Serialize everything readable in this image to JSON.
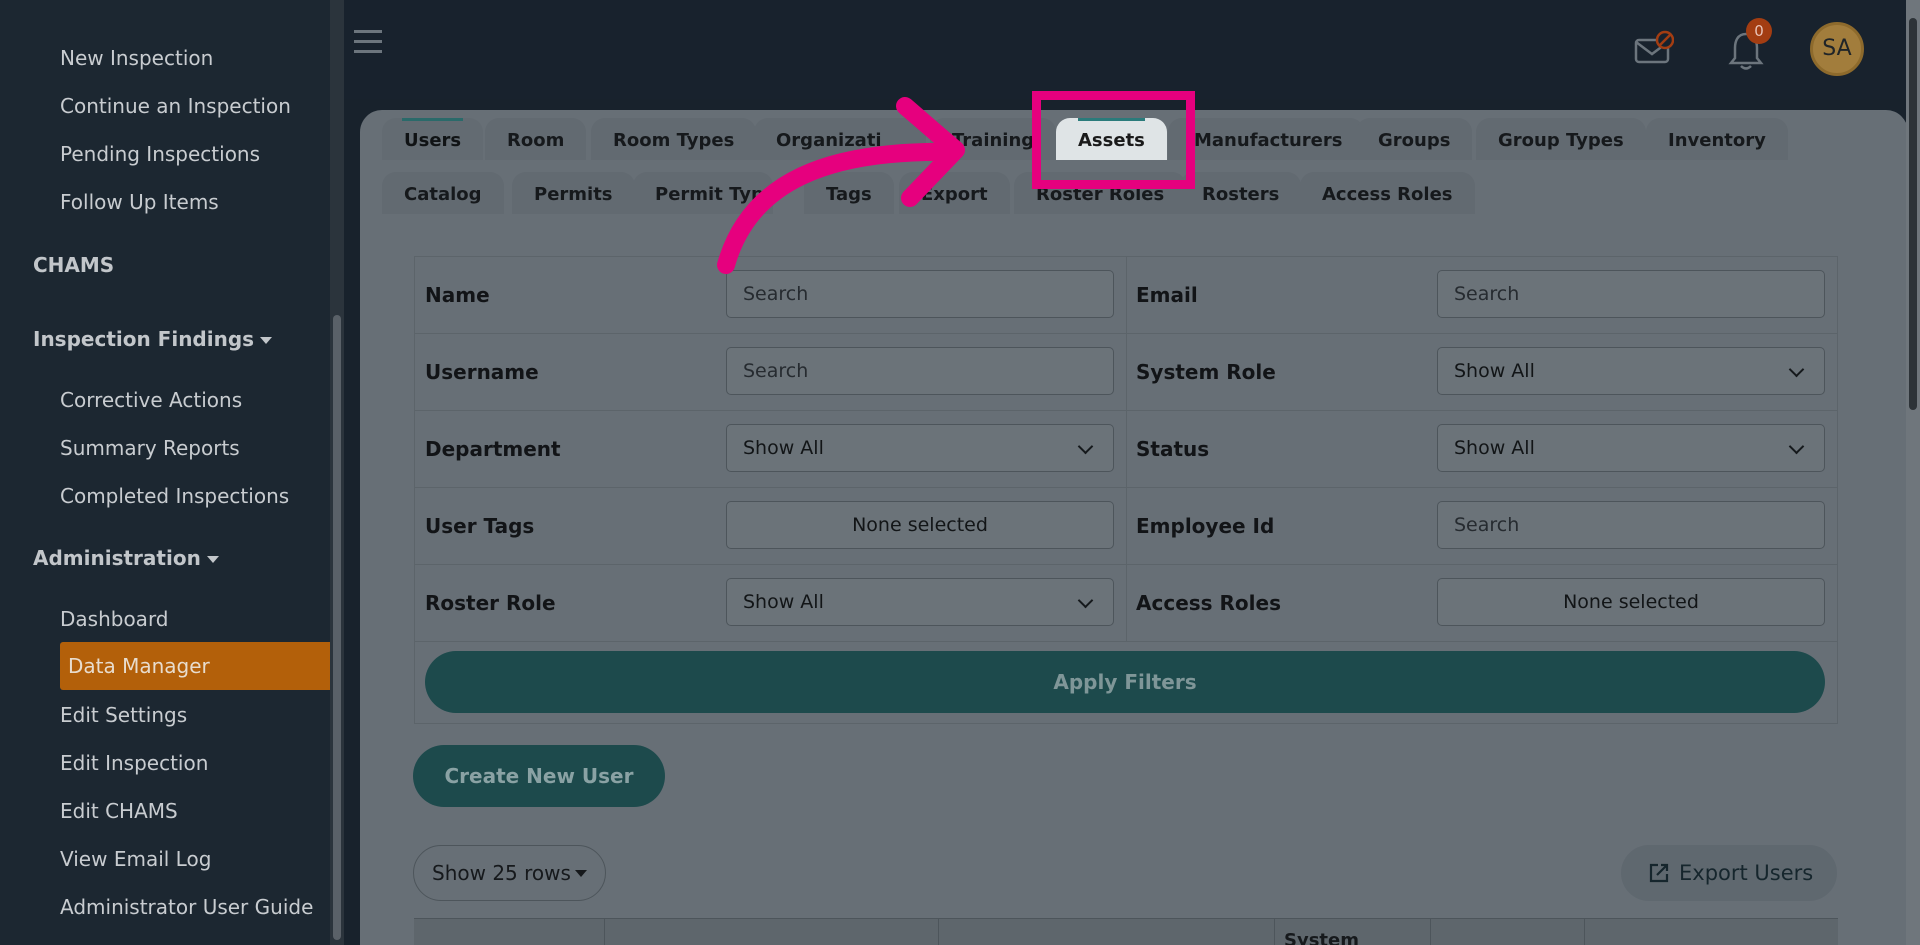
{
  "sidebar": {
    "inspection_items": [
      "New Inspection",
      "Continue an Inspection",
      "Pending Inspections",
      "Follow Up Items"
    ],
    "chams_label": "CHAMS",
    "findings_label": "Inspection Findings",
    "findings_items": [
      "Corrective Actions",
      "Summary Reports",
      "Completed Inspections"
    ],
    "admin_label": "Administration",
    "admin_items": [
      "Dashboard",
      "Data Manager",
      "Edit Settings",
      "Edit Inspection",
      "Edit CHAMS",
      "View Email Log",
      "Administrator User Guide"
    ],
    "active_item": "Data Manager"
  },
  "header": {
    "notification_count": "0",
    "avatar_initials": "SA",
    "icons": [
      "menu-icon",
      "mail-disabled-icon",
      "bell-icon"
    ]
  },
  "tabs": {
    "row1": [
      "Users",
      "Room",
      "Room Types",
      "Organizati",
      "Training",
      "Assets",
      "Manufacturers",
      "Groups",
      "Group Types",
      "Inventory"
    ],
    "row2": [
      "Catalog",
      "Permits",
      "Permit Typ",
      "Tags",
      "Export",
      "Roster Roles",
      "Rosters",
      "Access Roles"
    ],
    "selected": "Users",
    "highlighted": "Assets"
  },
  "filters": {
    "name_label": "Name",
    "name_placeholder": "Search",
    "email_label": "Email",
    "email_placeholder": "Search",
    "username_label": "Username",
    "username_placeholder": "Search",
    "system_role_label": "System Role",
    "system_role_value": "Show All",
    "department_label": "Department",
    "department_value": "Show All",
    "status_label": "Status",
    "status_value": "Show All",
    "user_tags_label": "User Tags",
    "user_tags_value": "None selected",
    "employee_id_label": "Employee Id",
    "employee_id_placeholder": "Search",
    "roster_role_label": "Roster Role",
    "roster_role_value": "Show All",
    "access_roles_label": "Access Roles",
    "access_roles_value": "None selected",
    "apply_label": "Apply Filters"
  },
  "actions": {
    "create_label": "Create New User",
    "rows_label": "Show 25 rows",
    "export_label": "Export Users"
  },
  "table": {
    "partial_header": "System"
  },
  "colors": {
    "highlight": "#e6007e",
    "active_sidebar": "#b3600a",
    "primary_button": "#1d4a4c"
  }
}
